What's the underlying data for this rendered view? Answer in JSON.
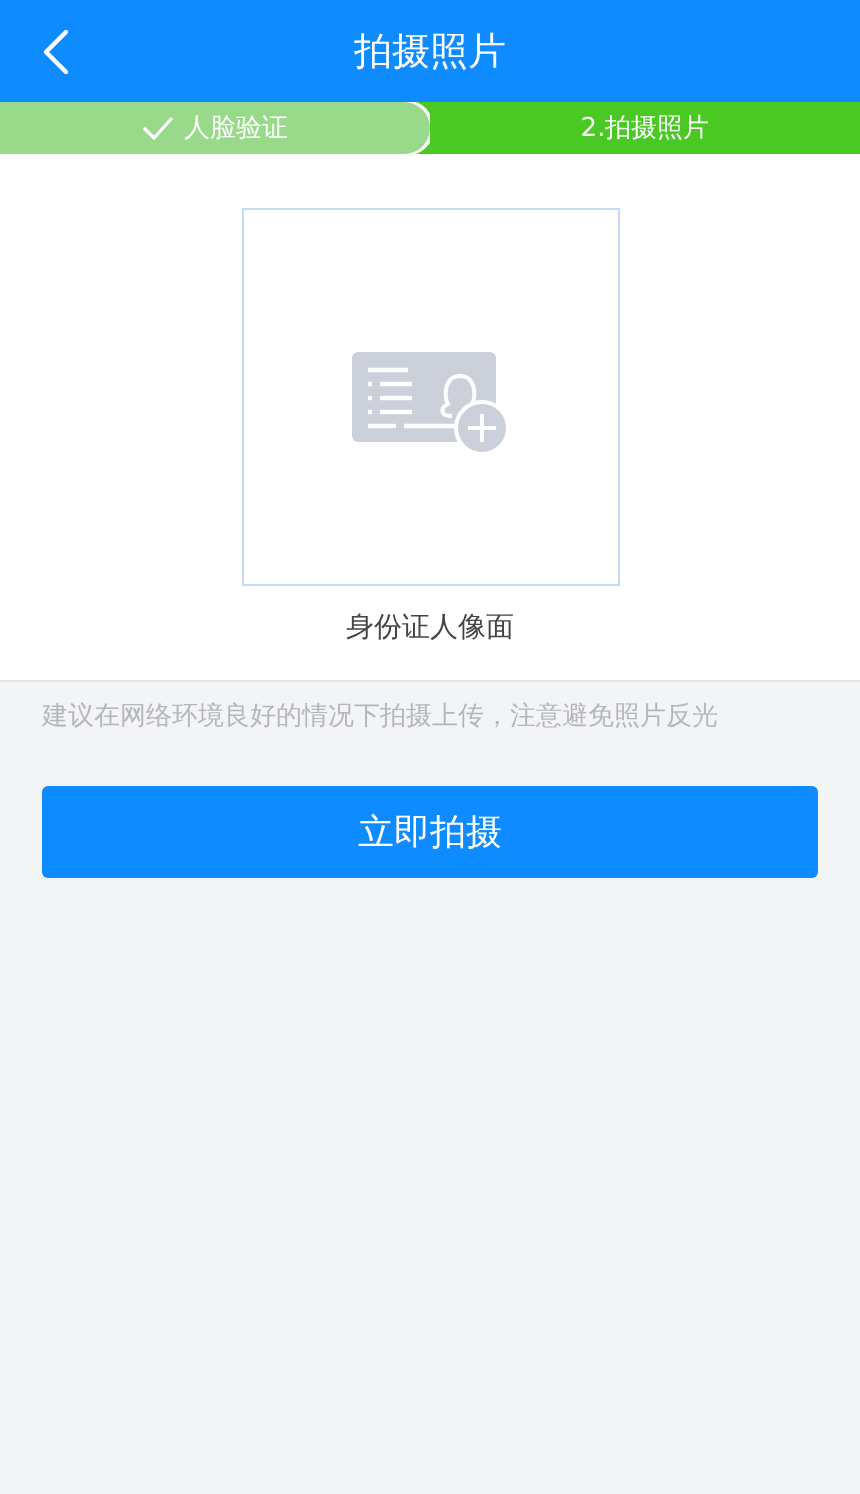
{
  "header": {
    "title": "拍摄照片"
  },
  "steps": [
    {
      "label": "人脸验证",
      "done": true
    },
    {
      "label": "2.拍摄照片",
      "done": false
    }
  ],
  "upload": {
    "caption": "身份证人像面"
  },
  "hint": "建议在网络环境良好的情况下拍摄上传，注意避免照片反光",
  "buttons": [
    "立即拍摄"
  ]
}
